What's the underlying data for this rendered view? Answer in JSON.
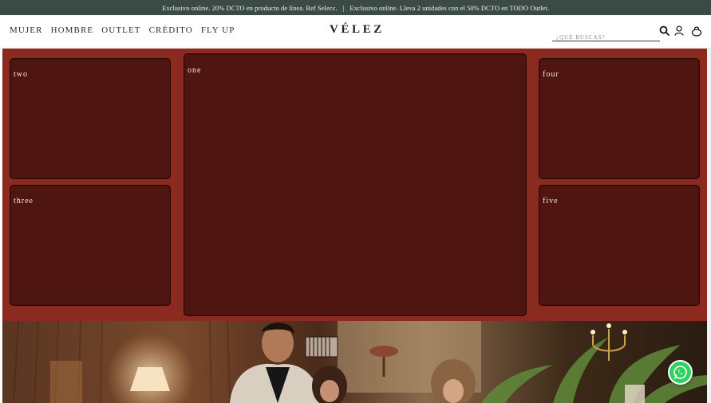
{
  "promo": {
    "message_1": "Exclusivo online. 20% DCTO en producto de línea. Ref Selecc.",
    "separator": "|",
    "message_2": "Exclusivo online. Lleva 2 unidades con el 50% DCTO en TODO Outlet."
  },
  "nav": {
    "items": [
      {
        "label": "MUJER"
      },
      {
        "label": "HOMBRE"
      },
      {
        "label": "OUTLET"
      },
      {
        "label": "CRÉDITO"
      },
      {
        "label": "FLY UP"
      }
    ]
  },
  "brand": {
    "logo": "VÉLEZ"
  },
  "search": {
    "placeholder": "¿QUE BUSCAS?",
    "value": ""
  },
  "icons": {
    "search": "search-icon",
    "account": "user-icon",
    "cart": "shopping-bag-icon",
    "chat": "whatsapp-icon"
  },
  "panels": {
    "one": "one",
    "two": "two",
    "three": "three",
    "four": "four",
    "five": "five"
  },
  "colors": {
    "promo_bg": "#3a4a44",
    "section_bg": "#8b2a1f",
    "panel_bg": "#4f1511",
    "whatsapp": "#2fd25f"
  }
}
